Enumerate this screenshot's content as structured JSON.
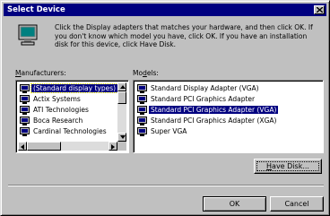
{
  "window": {
    "title": "Select Device"
  },
  "instructions": "Click the Display adapters that matches your hardware, and then click OK. If\nyou don't know which model you have, click OK. If you have an installation\ndisk for this device, click Have Disk.",
  "manufacturers": {
    "label_underlined": "M",
    "label_rest": "anufacturers:",
    "items": [
      {
        "label": "(Standard display types)",
        "selected": true
      },
      {
        "label": "Actix Systems"
      },
      {
        "label": "ATI Technologies"
      },
      {
        "label": "Boca Research"
      },
      {
        "label": "Cardinal Technologies"
      }
    ]
  },
  "models": {
    "label_start": "Mo",
    "label_underlined": "d",
    "label_end": "els:",
    "items": [
      {
        "label": "Standard Display Adapter (VGA)"
      },
      {
        "label": "Standard PCI Graphics Adapter"
      },
      {
        "label": "Standard PCI Graphics Adapter (VGA)",
        "highlighted": true
      },
      {
        "label": "Standard PCI Graphics Adapter (XGA)"
      },
      {
        "label": "Super VGA"
      }
    ]
  },
  "buttons": {
    "have_disk_underlined": "H",
    "have_disk_rest": "ave Disk...",
    "ok": "OK",
    "cancel": "Cancel"
  },
  "icons": {
    "title_close": "close-icon",
    "dialog": "monitor-icon",
    "list_item": "display-adapter-icon"
  }
}
